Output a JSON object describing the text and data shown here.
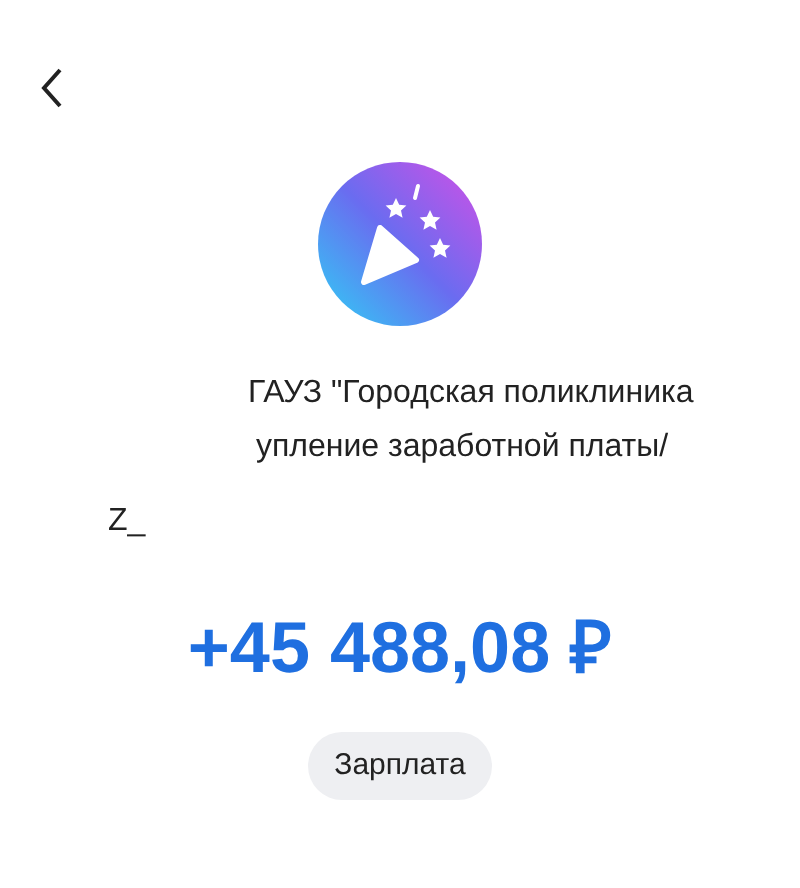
{
  "description_lines": [
    "ГАУЗ \"Городская поликлиника",
    "упление заработной платы/",
    "Z_"
  ],
  "amount": "+45 488,08 ₽",
  "category": "Зарплата"
}
